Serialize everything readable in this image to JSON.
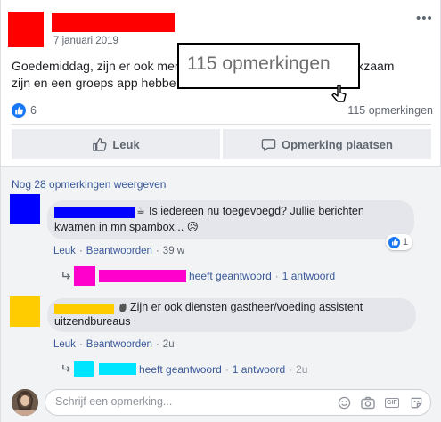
{
  "post": {
    "date": "7 januari 2019",
    "more_label": "•••",
    "body_line1": "Goedemiddag, zijn er ook men",
    "body_line1_tail": "werkzaam",
    "body_line2": "zijn en een groeps app hebbe",
    "like_count": "6",
    "comment_count": "115 opmerkingen",
    "like_button": "Leuk",
    "comment_button": "Opmerking plaatsen"
  },
  "callout": {
    "text": "115 opmerkingen"
  },
  "comments": {
    "view_more": "Nog 28 opmerkingen weergeven",
    "items": [
      {
        "text_line1": "Is iedereen nu toegevoegd? Jullie berichten",
        "text_line2": "kwamen in mn spambox...",
        "emoji": "😥",
        "like_label": "Leuk",
        "reply_label": "Beantwoorden",
        "time": "39 w",
        "reaction_count": "1",
        "reply_summary": "heeft geantwoord",
        "reply_count_label": "1 antwoord"
      },
      {
        "text_line1": "Zijn er ook diensten gastheer/voeding assistent",
        "text_line2": "uitzendbureaus",
        "like_label": "Leuk",
        "reply_label": "Beantwoorden",
        "time": "2u",
        "reply_summary": "heeft geantwoord",
        "reply_count_label": "1 antwoord",
        "reply_time": "2u"
      }
    ]
  },
  "composer": {
    "placeholder": "Schrijf een opmerking..."
  },
  "colors": {
    "link": "#385898",
    "like_blue": "#1877f2",
    "redact_red": "#ff0000",
    "redact_blue": "#0000ff",
    "redact_magenta": "#ff00cc",
    "redact_yellow": "#ffcc00",
    "redact_cyan": "#00e5ff"
  },
  "icons": [
    "more-dots-icon",
    "like-reaction-icon",
    "thumbs-up-icon",
    "comment-bubble-icon",
    "coffee-icon",
    "hand-wave-icon",
    "reply-arrow-icon",
    "smiley-icon",
    "camera-icon",
    "gif-icon",
    "sticker-icon",
    "mouse-cursor-icon"
  ]
}
